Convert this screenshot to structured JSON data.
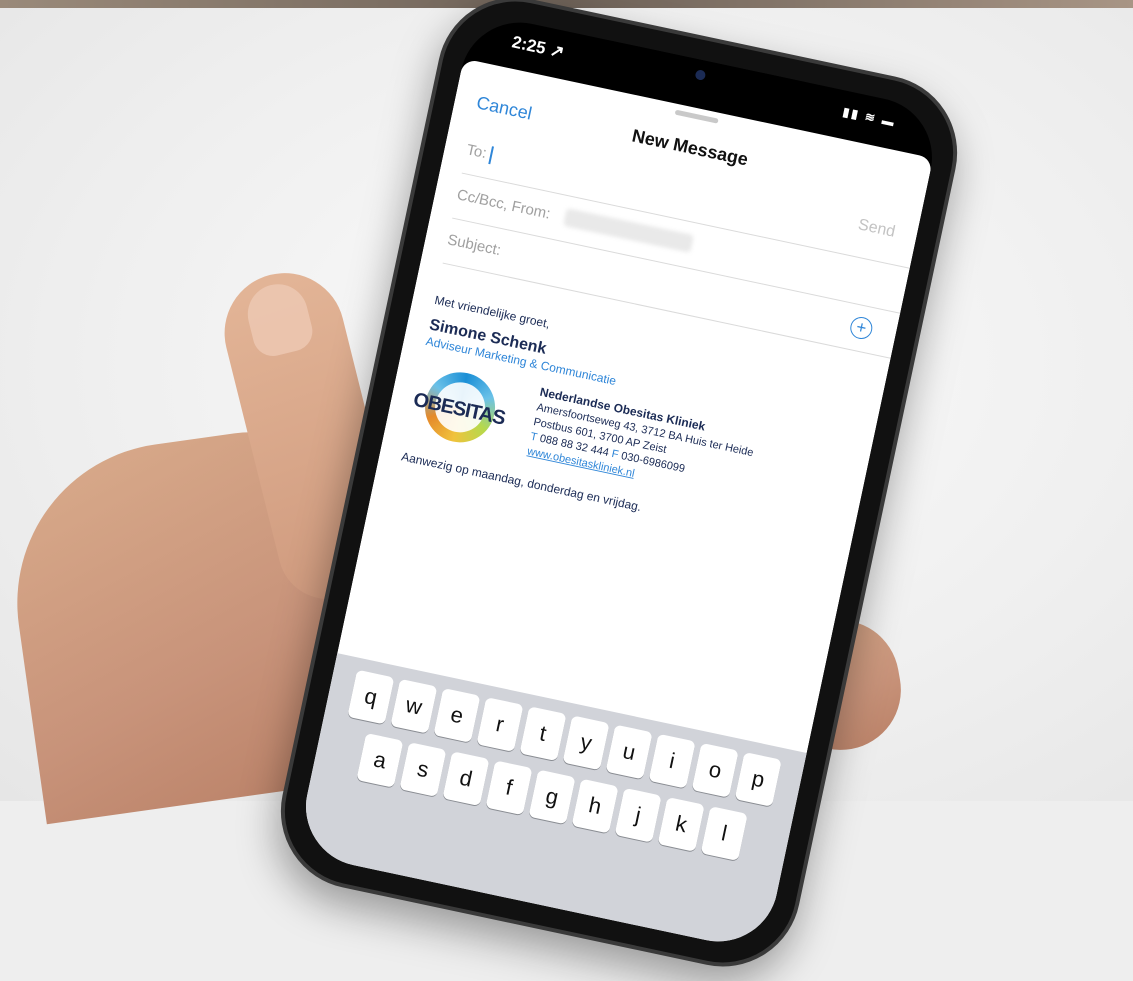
{
  "status": {
    "time": "2:25 ↗",
    "icons": "▮▮ ≋ ▬"
  },
  "mail": {
    "cancel": "Cancel",
    "title": "New Message",
    "send": "Send",
    "to": "To:",
    "cc": "Cc/Bcc, From:",
    "subject": "Subject:",
    "add": "+"
  },
  "signature": {
    "greeting": "Met vriendelijke groet,",
    "name": "Simone Schenk",
    "role": "Adviseur Marketing & Communicatie",
    "logo": "OBESITAS",
    "org": "Nederlandse Obesitas Kliniek",
    "address1": "Amersfoortseweg 43, 3712 BA Huis ter Heide",
    "address2": "Postbus 601, 3700 AP Zeist",
    "t_label": "T",
    "phone": "088 88 32 444",
    "f_label": "F",
    "fax": "030-6986099",
    "website": "www.obesitaskliniek.nl",
    "availability": "Aanwezig op maandag, donderdag en vrijdag."
  },
  "keyboard": {
    "row1": [
      "q",
      "w",
      "e",
      "r",
      "t",
      "y",
      "u",
      "i",
      "o",
      "p"
    ],
    "row2": [
      "a",
      "s",
      "d",
      "f",
      "g",
      "h",
      "j",
      "k",
      "l"
    ]
  }
}
